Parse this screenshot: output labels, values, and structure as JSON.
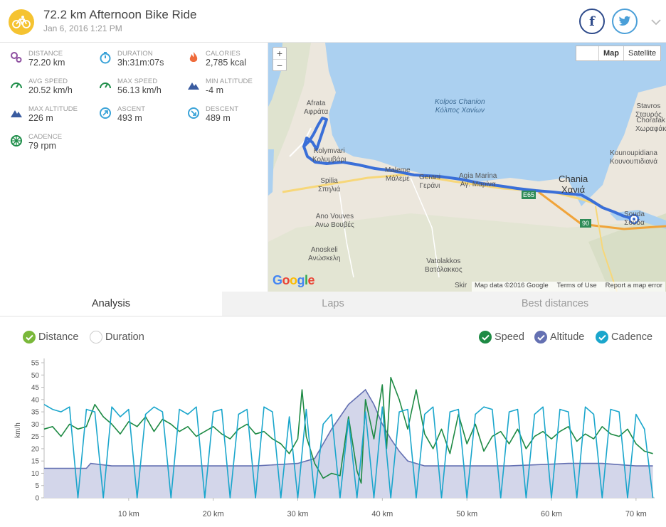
{
  "activity": {
    "title": "72.2 km Afternoon Bike Ride",
    "date": "Jan 6, 2016 1:21 PM",
    "icon": "bike-icon"
  },
  "share": {
    "facebook_label": "f",
    "twitter_icon": "twitter-icon"
  },
  "stats": [
    {
      "label": "DISTANCE",
      "value": "72.20 km",
      "icon": "distance-icon",
      "color": "#8e4fa0"
    },
    {
      "label": "DURATION",
      "value": "3h:31m:07s",
      "icon": "stopwatch-icon",
      "color": "#3aa3d8"
    },
    {
      "label": "CALORIES",
      "value": "2,785 kcal",
      "icon": "flame-icon",
      "color": "#ef6b3b"
    },
    {
      "label": "AVG SPEED",
      "value": "20.52 km/h",
      "icon": "speedometer-icon",
      "color": "#1f8e4a"
    },
    {
      "label": "MAX SPEED",
      "value": "56.13 km/h",
      "icon": "speedometer-icon",
      "color": "#1f8e4a"
    },
    {
      "label": "MIN ALTITUDE",
      "value": "-4 m",
      "icon": "mountain-icon",
      "color": "#3a5ca0"
    },
    {
      "label": "MAX ALTITUDE",
      "value": "226 m",
      "icon": "mountain-icon",
      "color": "#3a5ca0"
    },
    {
      "label": "ASCENT",
      "value": "493 m",
      "icon": "ascent-icon",
      "color": "#3aa3d8"
    },
    {
      "label": "DESCENT",
      "value": "489 m",
      "icon": "descent-icon",
      "color": "#3aa3d8"
    },
    {
      "label": "CADENCE",
      "value": "79 rpm",
      "icon": "cadence-icon",
      "color": "#1f8e4a"
    }
  ],
  "map": {
    "zoom_in": "+",
    "zoom_out": "−",
    "type_map": "Map",
    "type_satellite": "Satellite",
    "logo": "Google",
    "attribution": [
      "Map data ©2016 Google",
      "Terms of Use",
      "Report a map error"
    ],
    "cut_label": "Skir",
    "labels": {
      "gulf": "Kolpos Chanion",
      "gulf_gr": "Κόλπος Χανίων",
      "afrata": "Afrata",
      "afrata_gr": "Αφράτα",
      "kolymvari": "Kolymvari",
      "kolymvari_gr": "Κολυμβάρι",
      "spilia": "Spilia",
      "spilia_gr": "Σπηλιά",
      "maleme": "Maleme",
      "maleme_gr": "Μάλεμε",
      "gerani": "Gerani",
      "gerani_gr": "Γεράνι",
      "agia_marina": "Agia Marina",
      "agia_marina_gr": "Αγ. Μαρίνα",
      "chania": "Chania",
      "chania_gr": "Χανιά",
      "souda": "Souda",
      "souda_gr": "Σούδα",
      "ano_vouves": "Ano Vouves",
      "ano_vouves_gr": "Ανω Βουβές",
      "anoskeli": "Anoskeli",
      "anoskeli_gr": "Ανώσκελη",
      "vatolakkos": "Vatolakkos",
      "vatolakkos_gr": "Βατόλακκος",
      "stavros": "Stavros",
      "stavros_gr": "Σταυρός",
      "chorafakia": "Chorafak",
      "chorafakia_gr": "Χωραφάκ",
      "kounoupidiana": "Kounoupidiana",
      "kounoupidiana_gr": "Κουνουπιδιανά",
      "e65": "E65",
      "r90": "90"
    },
    "route_color": "#3a6fd8"
  },
  "tabs": [
    "Analysis",
    "Laps",
    "Best distances"
  ],
  "toggles": {
    "distance": "Distance",
    "duration": "Duration",
    "speed": "Speed",
    "altitude": "Altitude",
    "cadence": "Cadence"
  },
  "colors": {
    "speed": "#1e8a44",
    "altitude": "#6470b2",
    "altitude_fill": "#d3d6ea",
    "cadence": "#1aa6cc",
    "check_green": "#7ab83a"
  },
  "chart_data": {
    "type": "line",
    "x_unit": "km",
    "ylabel": "km/h",
    "ylim": [
      0,
      55
    ],
    "yticks": [
      0,
      5,
      10,
      15,
      20,
      25,
      30,
      35,
      40,
      45,
      50,
      55
    ],
    "xlim": [
      0,
      72.2
    ],
    "xticks": [
      10,
      20,
      30,
      40,
      50,
      60,
      70
    ],
    "xtick_labels": [
      "10 km",
      "20 km",
      "30 km",
      "40 km",
      "50 km",
      "60 km",
      "70 km"
    ],
    "series": [
      {
        "name": "Altitude",
        "x": [
          0,
          2,
          5,
          5.5,
          8,
          12,
          18,
          25,
          30,
          32,
          33,
          34,
          35,
          36,
          37,
          38,
          39,
          40,
          41,
          42,
          43,
          45,
          48,
          55,
          62,
          66,
          70,
          72
        ],
        "y": [
          12,
          12,
          12,
          14,
          13,
          13,
          13,
          13,
          14,
          16,
          22,
          28,
          33,
          38,
          41,
          44,
          38,
          30,
          24,
          19,
          15,
          13,
          13,
          13,
          14,
          14,
          13,
          13
        ]
      },
      {
        "name": "Speed",
        "x": [
          0,
          1,
          2,
          3,
          4,
          5,
          6,
          7,
          8,
          9,
          10,
          11,
          12,
          13,
          14,
          15,
          16,
          17,
          18,
          19,
          20,
          21,
          22,
          23,
          24,
          25,
          26,
          27,
          28,
          29,
          30,
          30.5,
          31,
          32,
          33,
          34,
          35,
          36,
          37,
          37.5,
          38,
          39,
          40,
          40.5,
          41,
          42,
          43,
          44,
          45,
          46,
          47,
          48,
          49,
          50,
          51,
          52,
          53,
          54,
          55,
          56,
          57,
          58,
          59,
          60,
          61,
          62,
          63,
          64,
          65,
          66,
          67,
          68,
          69,
          70,
          71,
          72
        ],
        "y": [
          28,
          29,
          25,
          30,
          28,
          29,
          38,
          33,
          30,
          26,
          31,
          29,
          33,
          27,
          32,
          30,
          27,
          29,
          25,
          27,
          29,
          26,
          24,
          28,
          30,
          26,
          27,
          24,
          22,
          18,
          24,
          44,
          25,
          14,
          8,
          10,
          9,
          33,
          11,
          6,
          40,
          24,
          46,
          20,
          49,
          40,
          28,
          44,
          26,
          20,
          28,
          18,
          34,
          22,
          30,
          19,
          25,
          27,
          22,
          28,
          20,
          25,
          27,
          24,
          27,
          29,
          23,
          26,
          24,
          29,
          26,
          25,
          28,
          22,
          19,
          18
        ]
      },
      {
        "name": "Cadence",
        "x": [
          0,
          1,
          2,
          3,
          4,
          5,
          6,
          7,
          8,
          9,
          10,
          11,
          12,
          13,
          14,
          15,
          16,
          17,
          18,
          19,
          20,
          21,
          22,
          23,
          24,
          25,
          26,
          27,
          28,
          29,
          30,
          31,
          32,
          33,
          34,
          35,
          36,
          37,
          38,
          39,
          40,
          41,
          42,
          43,
          44,
          45,
          46,
          47,
          48,
          49,
          50,
          51,
          52,
          53,
          54,
          55,
          56,
          57,
          58,
          59,
          60,
          61,
          62,
          63,
          64,
          65,
          66,
          67,
          68,
          69,
          70,
          71,
          72
        ],
        "y": [
          38,
          36,
          35,
          37,
          0,
          36,
          35,
          0,
          37,
          33,
          36,
          0,
          34,
          37,
          35,
          0,
          36,
          34,
          37,
          0,
          35,
          36,
          0,
          34,
          36,
          0,
          37,
          35,
          0,
          33,
          0,
          36,
          0,
          30,
          34,
          0,
          32,
          0,
          35,
          0,
          37,
          0,
          35,
          36,
          0,
          34,
          37,
          0,
          35,
          36,
          0,
          34,
          37,
          36,
          0,
          35,
          36,
          0,
          34,
          37,
          0,
          36,
          35,
          0,
          37,
          34,
          0,
          36,
          35,
          0,
          34,
          28,
          0
        ]
      }
    ]
  }
}
